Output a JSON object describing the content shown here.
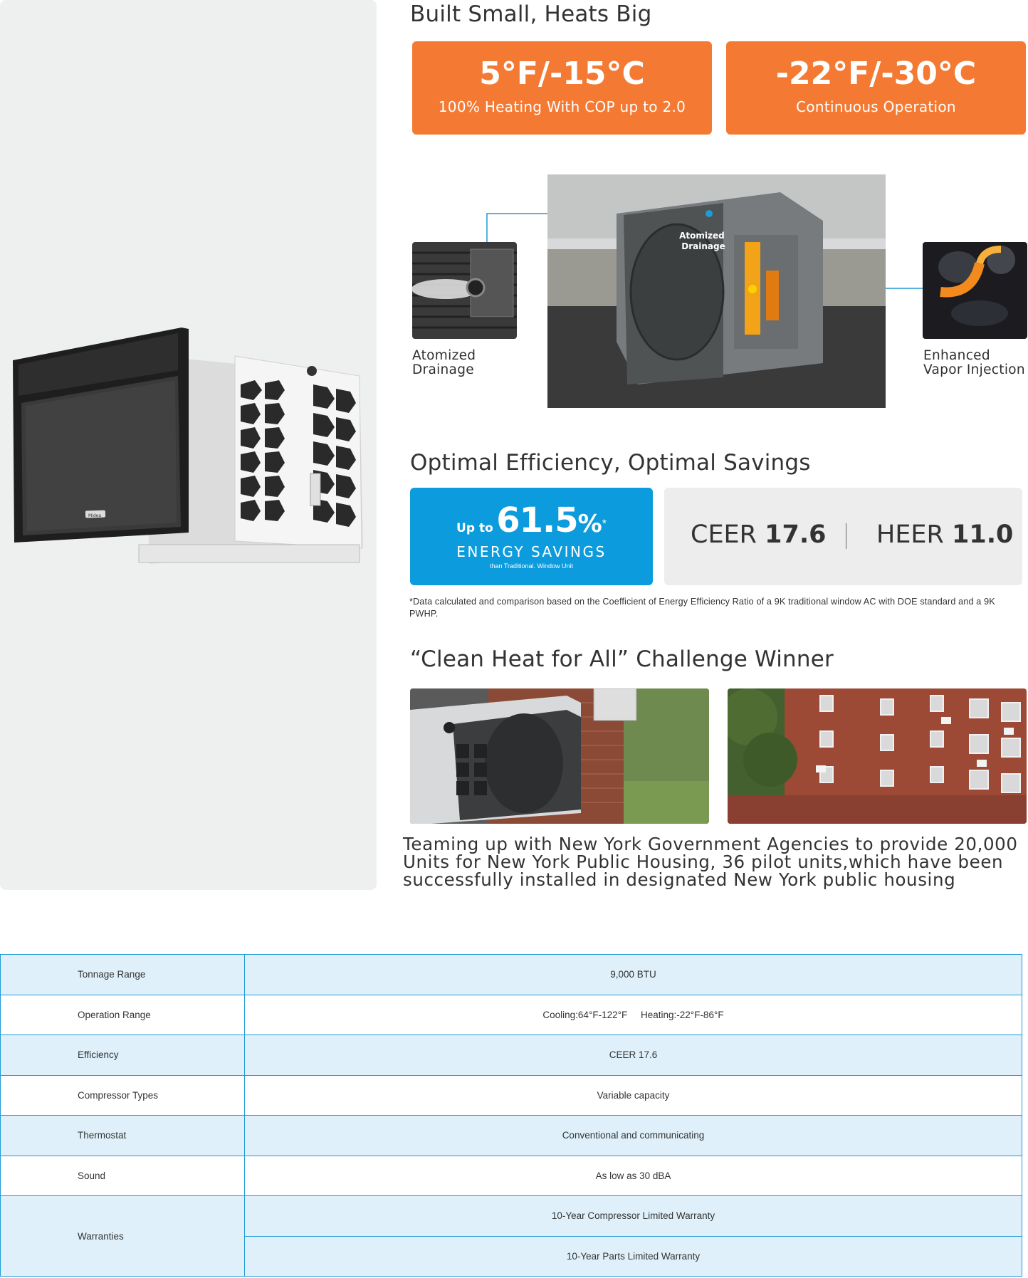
{
  "sections": {
    "heading1": "Built Small, Heats Big",
    "heading2": "Optimal Efficiency, Optimal Savings",
    "heading3": "“Clean Heat for All” Challenge Winner"
  },
  "temp_cards": [
    {
      "big": "5°F/-15°C",
      "small": "100% Heating With COP up to 2.0"
    },
    {
      "big": "-22°F/-30°C",
      "small": "Continuous Operation"
    }
  ],
  "features": {
    "left_label": "Atomized\nDrainage",
    "right_label": "Enhanced\nVapor Injection",
    "overlay_label": "Atomized\nDrainage",
    "product_logo": "Midea"
  },
  "savings": {
    "up_to": "Up to",
    "percent_number": "61.5",
    "percent_sign": "%",
    "asterisk": "*",
    "energy": "ENERGY SAVINGS",
    "than": "than Traditional. Window Unit"
  },
  "ratings": {
    "ceer_label": "CEER",
    "ceer_value": "17.6",
    "heer_label": "HEER",
    "heer_value": "11.0"
  },
  "footnote": "*Data calculated and comparison based on the Coefficient of Energy Efficiency Ratio of a 9K traditional window AC with DOE standard and a 9K PWHP.",
  "teamup": "Teaming up with New York Government Agencies to provide 20,000 Units for New York Public Housing, 36 pilot units,which have been successfully installed in designated New York public housing",
  "specs": {
    "rows": [
      {
        "label": "Tonnage Range",
        "value": "9,000 BTU"
      },
      {
        "label": "Operation Range",
        "value": "Cooling:64°F-122°F     Heating:-22°F-86°F"
      },
      {
        "label": "Efficiency",
        "value": "CEER 17.6"
      },
      {
        "label": "Compressor Types",
        "value": "Variable capacity"
      },
      {
        "label": "Thermostat",
        "value": "Conventional and communicating"
      },
      {
        "label": "Sound",
        "value": "As low as 30 dBA"
      }
    ],
    "warranty_label": "Warranties",
    "warranty_values": [
      "10-Year Compressor Limited Warranty",
      "10-Year Parts Limited Warranty"
    ]
  },
  "colors": {
    "orange": "#f47a33",
    "blue": "#0c9bdc",
    "table_border": "#1f9ad6",
    "table_shade": "#dff0fa"
  }
}
